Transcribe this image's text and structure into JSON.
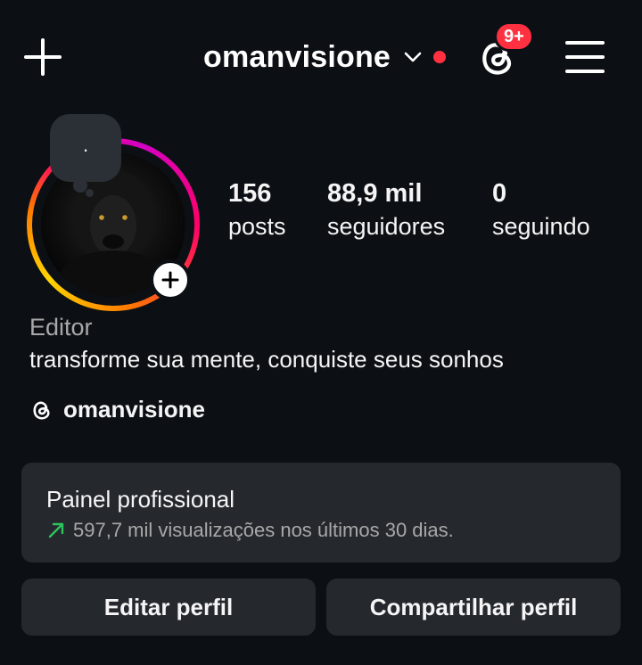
{
  "header": {
    "username": "omanvisione",
    "notification_badge": "9+"
  },
  "profile": {
    "note_text": ".",
    "stats": [
      {
        "value": "156",
        "label": "posts"
      },
      {
        "value": "88,9 mil",
        "label": "seguidores"
      },
      {
        "value": "0",
        "label": "seguindo"
      }
    ],
    "category": "Editor",
    "bio": "transforme sua mente, conquiste seus sonhos",
    "threads_handle": "omanvisione"
  },
  "dashboard": {
    "title": "Painel profissional",
    "subtitle": "597,7 mil visualizações nos últimos 30 dias."
  },
  "actions": {
    "edit_profile": "Editar perfil",
    "share_profile": "Compartilhar perfil"
  },
  "icons": {
    "create": "plus-icon",
    "dropdown": "chevron-down-icon",
    "threads": "threads-icon",
    "menu": "hamburger-menu-icon",
    "trend": "trend-up-arrow-icon"
  },
  "colors": {
    "background": "#0c1014",
    "surface": "#25292e",
    "accent_red": "#ff3040",
    "trend_green": "#2cc45c",
    "muted_text": "#a8a8a8"
  }
}
